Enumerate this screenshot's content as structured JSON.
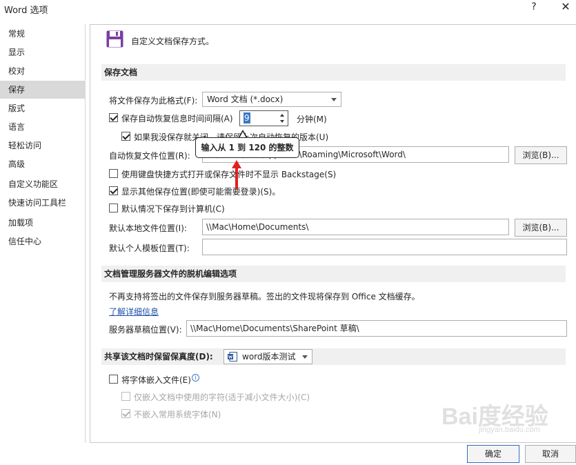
{
  "window": {
    "title": "Word 选项",
    "help": "?",
    "close": "✕"
  },
  "sidebar": {
    "items": [
      {
        "label": "常规"
      },
      {
        "label": "显示"
      },
      {
        "label": "校对"
      },
      {
        "label": "保存",
        "selected": true
      },
      {
        "label": "版式"
      },
      {
        "label": "语言"
      },
      {
        "label": "轻松访问"
      },
      {
        "label": "高级"
      },
      {
        "label": "自定义功能区"
      },
      {
        "label": "快速访问工具栏"
      },
      {
        "label": "加载项"
      },
      {
        "label": "信任中心"
      }
    ]
  },
  "header": {
    "title": "自定义文档保存方式。"
  },
  "save_section": {
    "title": "保存文档",
    "format_label": "将文件保存为此格式(F):",
    "format_value": "Word 文档 (*.docx)",
    "autorecover_label": "保存自动恢复信息时间间隔(A)",
    "autorecover_checked": true,
    "autorecover_minutes": "9",
    "minutes_label": "分钟(M)",
    "keep_version_label": "如果我没保存就关闭，请保留上次自动恢复的版本(U)",
    "keep_version_checked": true,
    "autorecover_location_label": "自动恢复文件位置(R):",
    "autorecover_location_value": "C:\\Users\\Mac\\AppData\\Roaming\\Microsoft\\Word\\",
    "browse1": "浏览(B)...",
    "backstage_label": "使用键盘快捷方式打开或保存文件时不显示 Backstage(S)",
    "backstage_checked": false,
    "show_locations_label": "显示其他保存位置(即使可能需要登录)(S)。",
    "show_locations_checked": true,
    "save_to_computer_label": "默认情况下保存到计算机(C)",
    "save_to_computer_checked": false,
    "local_location_label": "默认本地文件位置(I):",
    "local_location_value": "\\\\Mac\\Home\\Documents\\",
    "browse2": "浏览(B)...",
    "template_location_label": "默认个人模板位置(T):",
    "template_location_value": ""
  },
  "tooltip": {
    "text": "输入从 1 到 120 的整数"
  },
  "offline_section": {
    "title": "文档管理服务器文件的脱机编辑选项",
    "description": "不再支持将签出的文件保存到服务器草稿。签出的文件现将保存到 Office 文档缓存。",
    "learn_more": "了解详细信息",
    "drafts_label": "服务器草稿位置(V):",
    "drafts_value": "\\\\Mac\\Home\\Documents\\SharePoint 草稿\\"
  },
  "fidelity_section": {
    "title": "共享该文档时保留保真度(D):",
    "document_value": "word版本测试",
    "embed_fonts_label": "将字体嵌入文件(E)",
    "embed_fonts_checked": false,
    "embed_used_chars_label": "仅嵌入文档中使用的字符(适于减小文件大小)(C)",
    "embed_used_chars_checked": false,
    "no_common_fonts_label": "不嵌入常用系统字体(N)",
    "no_common_fonts_checked": true
  },
  "footer": {
    "ok": "确定",
    "cancel": "取消"
  },
  "watermark": {
    "main": "Bai度经验",
    "sub": "jingyan.baidu.com"
  },
  "colors": {
    "accent": "#7a3fa0",
    "selection": "#3b78c4",
    "section_bg": "#f0f0f0"
  },
  "icons": {
    "save": "save-floppy-icon",
    "info": "info-icon",
    "word_doc": "word-doc-icon"
  }
}
